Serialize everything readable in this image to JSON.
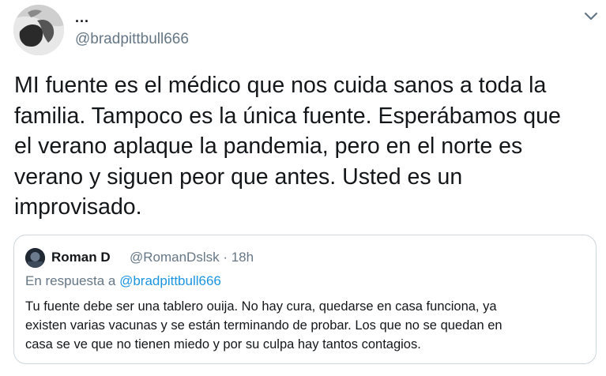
{
  "tweet": {
    "display_name": "...",
    "handle": "@bradpittbull666",
    "avatar_icon": "profile-photo",
    "menu_icon": "chevron-down-icon",
    "text": "MI fuente es el médico que nos cuida sanos a toda la\nfamilia. Tampoco es la única fuente. Esperábamos que\nel verano aplaque la pandemia, pero en el norte es\nverano y siguen peor que antes. Usted es un\nimprovisado."
  },
  "quoted_tweet": {
    "display_name": "Roman D",
    "meta": "@RomanDslsk · 18h",
    "reply_prefix": "En respuesta a ",
    "reply_mention": "@bradpittbull666",
    "text": "Tu fuente debe ser una tablero ouija. No hay cura, quedarse en casa funciona, ya\nexisten varias vacunas y se están terminando de probar. Los que no se quedan en\ncasa se ve que no tienen miedo y por su culpa hay tantos contagios."
  },
  "colors": {
    "text_primary": "#14171a",
    "text_secondary": "#657786",
    "link": "#1b95e0",
    "border": "#ccd6dd"
  }
}
